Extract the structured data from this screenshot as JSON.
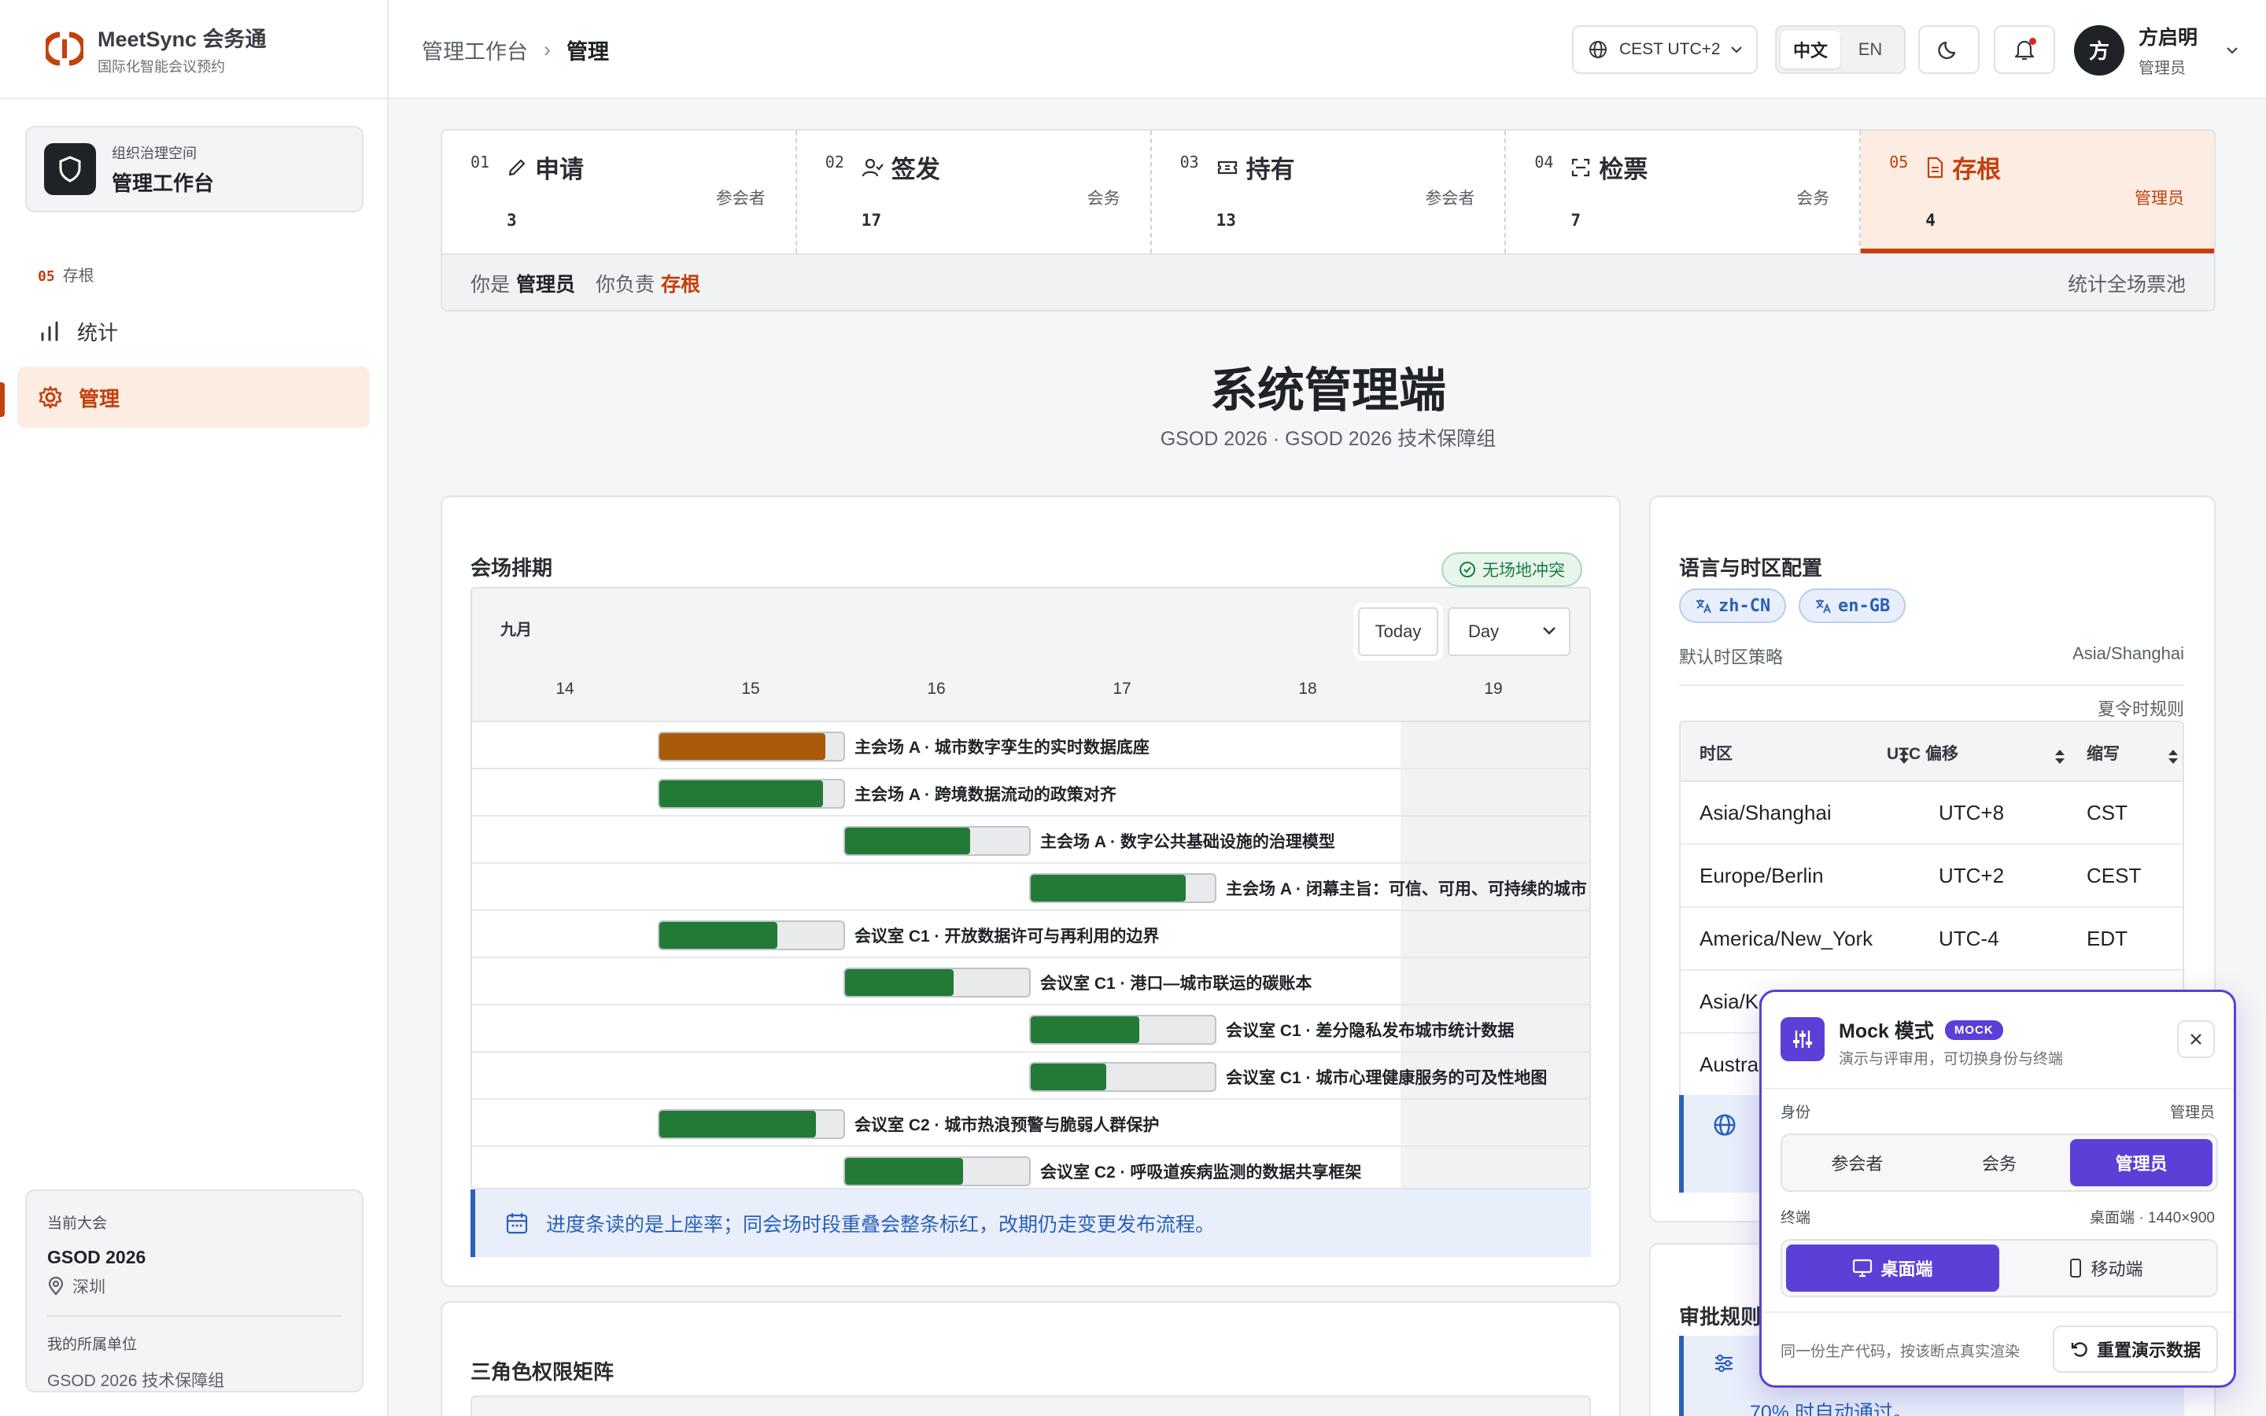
{
  "brand": {
    "name": "MeetSync 会务通",
    "tagline": "国际化智能会议预约"
  },
  "workspace": {
    "label": "组织治理空间",
    "name": "管理工作台"
  },
  "sidebar": {
    "section_num": "05",
    "section_label": "存根",
    "items": [
      {
        "label": "统计",
        "icon": "bar-chart-icon",
        "active": false
      },
      {
        "label": "管理",
        "icon": "gear-icon",
        "active": true
      }
    ]
  },
  "conference": {
    "label": "当前大会",
    "name": "GSOD 2026",
    "city": "深圳",
    "unit_label": "我的所属单位",
    "unit": "GSOD 2026 技术保障组"
  },
  "breadcrumb": {
    "root": "管理工作台",
    "current": "管理"
  },
  "topbar": {
    "timezone": "CEST UTC+2",
    "lang_zh": "中文",
    "lang_en": "EN",
    "user_initial": "方",
    "user_name": "方启明",
    "user_role": "管理员"
  },
  "steps": [
    {
      "num": "01",
      "title": "申请",
      "role": "参会者",
      "count": "3",
      "icon": "pencil-icon"
    },
    {
      "num": "02",
      "title": "签发",
      "role": "会务",
      "count": "17",
      "icon": "user-check-icon"
    },
    {
      "num": "03",
      "title": "持有",
      "role": "参会者",
      "count": "13",
      "icon": "ticket-icon"
    },
    {
      "num": "04",
      "title": "检票",
      "role": "会务",
      "count": "7",
      "icon": "scan-icon"
    },
    {
      "num": "05",
      "title": "存根",
      "role": "管理员",
      "count": "4",
      "icon": "file-icon"
    }
  ],
  "step_status": {
    "you_are": "你是",
    "role": "管理员",
    "responsible": "你负责",
    "stage": "存根",
    "right": "统计全场票池"
  },
  "page": {
    "title": "系统管理端",
    "subtitle": "GSOD 2026 · GSOD 2026 技术保障组"
  },
  "schedule": {
    "title": "会场排期",
    "status_chip": "无场地冲突",
    "month": "九月",
    "today_btn": "Today",
    "view_select": "Day",
    "days": [
      "14",
      "15",
      "16",
      "17",
      "18",
      "19"
    ],
    "sessions": [
      {
        "label": "主会场 A · 城市数字孪生的实时数据底座",
        "day_index": 1,
        "fill": 0.9,
        "status": "warn"
      },
      {
        "label": "主会场 A · 跨境数据流动的政策对齐",
        "day_index": 1,
        "fill": 0.89,
        "status": "ok"
      },
      {
        "label": "主会场 A · 数字公共基础设施的治理模型",
        "day_index": 2,
        "fill": 0.68,
        "status": "ok"
      },
      {
        "label": "主会场 A · 闭幕主旨：可信、可用、可持续的城市",
        "day_index": 3,
        "fill": 0.84,
        "status": "ok"
      },
      {
        "label": "会议室 C1 · 开放数据许可与再利用的边界",
        "day_index": 1,
        "fill": 0.64,
        "status": "ok"
      },
      {
        "label": "会议室 C1 · 港口—城市联运的碳账本",
        "day_index": 2,
        "fill": 0.59,
        "status": "ok"
      },
      {
        "label": "会议室 C1 · 差分隐私发布城市统计数据",
        "day_index": 3,
        "fill": 0.59,
        "status": "ok"
      },
      {
        "label": "会议室 C1 · 城市心理健康服务的可及性地图",
        "day_index": 3,
        "fill": 0.41,
        "status": "ok"
      },
      {
        "label": "会议室 C2 · 城市热浪预警与脆弱人群保护",
        "day_index": 1,
        "fill": 0.85,
        "status": "ok"
      },
      {
        "label": "会议室 C2 · 呼吸道疾病监测的数据共享框架",
        "day_index": 2,
        "fill": 0.64,
        "status": "ok"
      }
    ],
    "tip": "进度条读的是上座率；同会场时段重叠会整条标红，改期仍走变更发布流程。"
  },
  "locale_card": {
    "title": "语言与时区配置",
    "langs": [
      "zh-CN",
      "en-GB"
    ],
    "default_tz_label": "默认时区策略",
    "default_tz": "Asia/Shanghai",
    "dst_label": "夏令时规则",
    "columns": [
      "时区",
      "UTC 偏移",
      "缩写"
    ],
    "rows": [
      [
        "Asia/Shanghai",
        "UTC+8",
        "CST"
      ],
      [
        "Europe/Berlin",
        "UTC+2",
        "CEST"
      ],
      [
        "America/New_York",
        "UTC-4",
        "EDT"
      ],
      [
        "Asia/Ko",
        "",
        ""
      ],
      [
        "Austra",
        "",
        ""
      ]
    ]
  },
  "matrix_card": {
    "title": "三角色权限矩阵"
  },
  "approval_card": {
    "title": "审批规则",
    "text": "70% 时自动通过。"
  },
  "mock": {
    "title": "Mock 模式",
    "badge": "MOCK",
    "subtitle": "演示与评审用，可切换身份与终端",
    "identity_label": "身份",
    "identity_value": "管理员",
    "identities": [
      "参会者",
      "会务",
      "管理员"
    ],
    "terminal_label": "终端",
    "terminal_value": "桌面端 · 1440×900",
    "terminals": [
      "桌面端",
      "移动端"
    ],
    "note": "同一份生产代码，按该断点真实渲染",
    "reset": "重置演示数据"
  }
}
